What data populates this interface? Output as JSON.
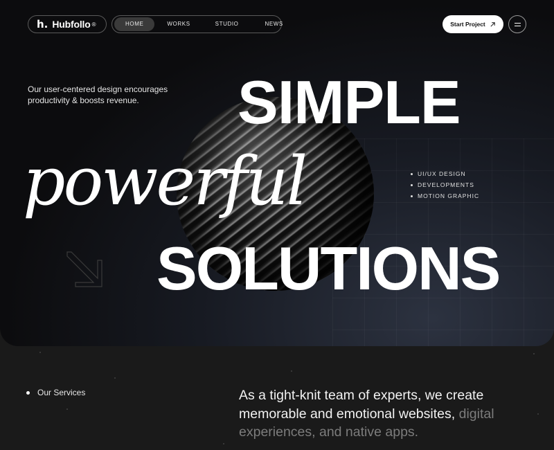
{
  "brand": {
    "mark": "h.",
    "name": "Hubfollo",
    "reg": "®"
  },
  "nav": {
    "items": [
      {
        "label": "HOME",
        "active": true
      },
      {
        "label": "WORKS",
        "active": false
      },
      {
        "label": "STUDIO",
        "active": false
      },
      {
        "label": "NEWS",
        "active": false
      }
    ],
    "cta_label": "Start Project",
    "cta_icon": "arrow-up-right-icon",
    "menu_icon": "hamburger-menu-icon"
  },
  "hero": {
    "tagline": "Our user-centered design encourages productivity & boosts revenue.",
    "line1": "SIMPLE",
    "line2": "powerful",
    "line3": "SOLUTIONS",
    "services": [
      "UI/UX DESIGN",
      "DEVELOPMENTS",
      "MOTION GRAPHIC"
    ]
  },
  "about": {
    "section_label": "Our Services",
    "statement_bright": "As a tight-knit team of experts, we create memorable and emotional websites,",
    "statement_dim": "digital experiences, and native apps."
  },
  "colors": {
    "accent": "#ffffff",
    "background": "#1a1a1a",
    "hero_bg": "#0c0c0e"
  }
}
